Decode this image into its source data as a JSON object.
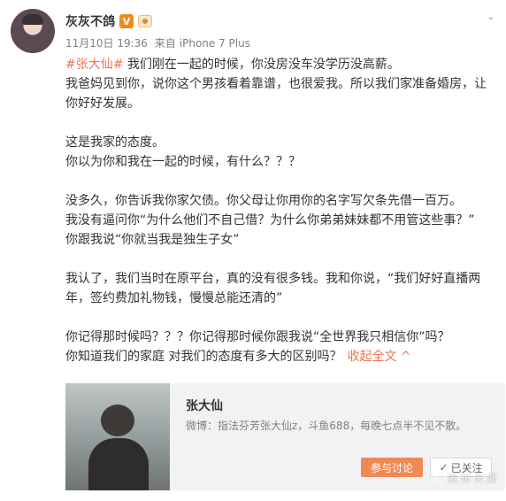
{
  "post": {
    "username": "灰灰不鸽",
    "vip_badge": "V",
    "time": "11月10日 19:36",
    "source_prefix": "来自",
    "source": "iPhone 7 Plus",
    "hashtag": "#张大仙#",
    "lines": [
      "我们刚在一起的时候，你没房没车没学历没高薪。",
      "我爸妈见到你，说你这个男孩看着靠谱，也很爱我。所以我们家准备婚房，让你好好发展。",
      "",
      "这是我家的态度。",
      "你以为你和我在一起的时候，有什么？？？",
      "",
      "没多久，你告诉我你家欠债。你父母让你用你的名字写欠条先借一百万。",
      "我没有逼问你“为什么他们不自己借？为什么你弟弟妹妹都不用管这些事？”",
      "你跟我说“你就当我是独生子女”",
      "",
      "我认了，我们当时在原平台，真的没有很多钱。我和你说，“我们好好直播两年，签约费加礼物钱，慢慢总能还清的”",
      "",
      "你记得那时候吗？？？你记得那时候你跟我说“全世界我只相信你”吗？",
      "你知道我们的家庭 对我们的态度有多大的区别吗？"
    ],
    "collapse_label": "收起全文",
    "collapse_arrow": "^"
  },
  "card": {
    "title": "张大仙",
    "description": "微博：指法芬芳张大仙z，斗鱼688，每晚七点半不见不散。",
    "discuss_label": "参与讨论",
    "follow_label": "已关注",
    "follow_icon": "✓"
  },
  "watermark": {
    "text": "麦 玩 天 涯"
  },
  "colors": {
    "link": "#eb7350",
    "discuss_button": "#f08a54",
    "vip": "#f08a1d"
  }
}
